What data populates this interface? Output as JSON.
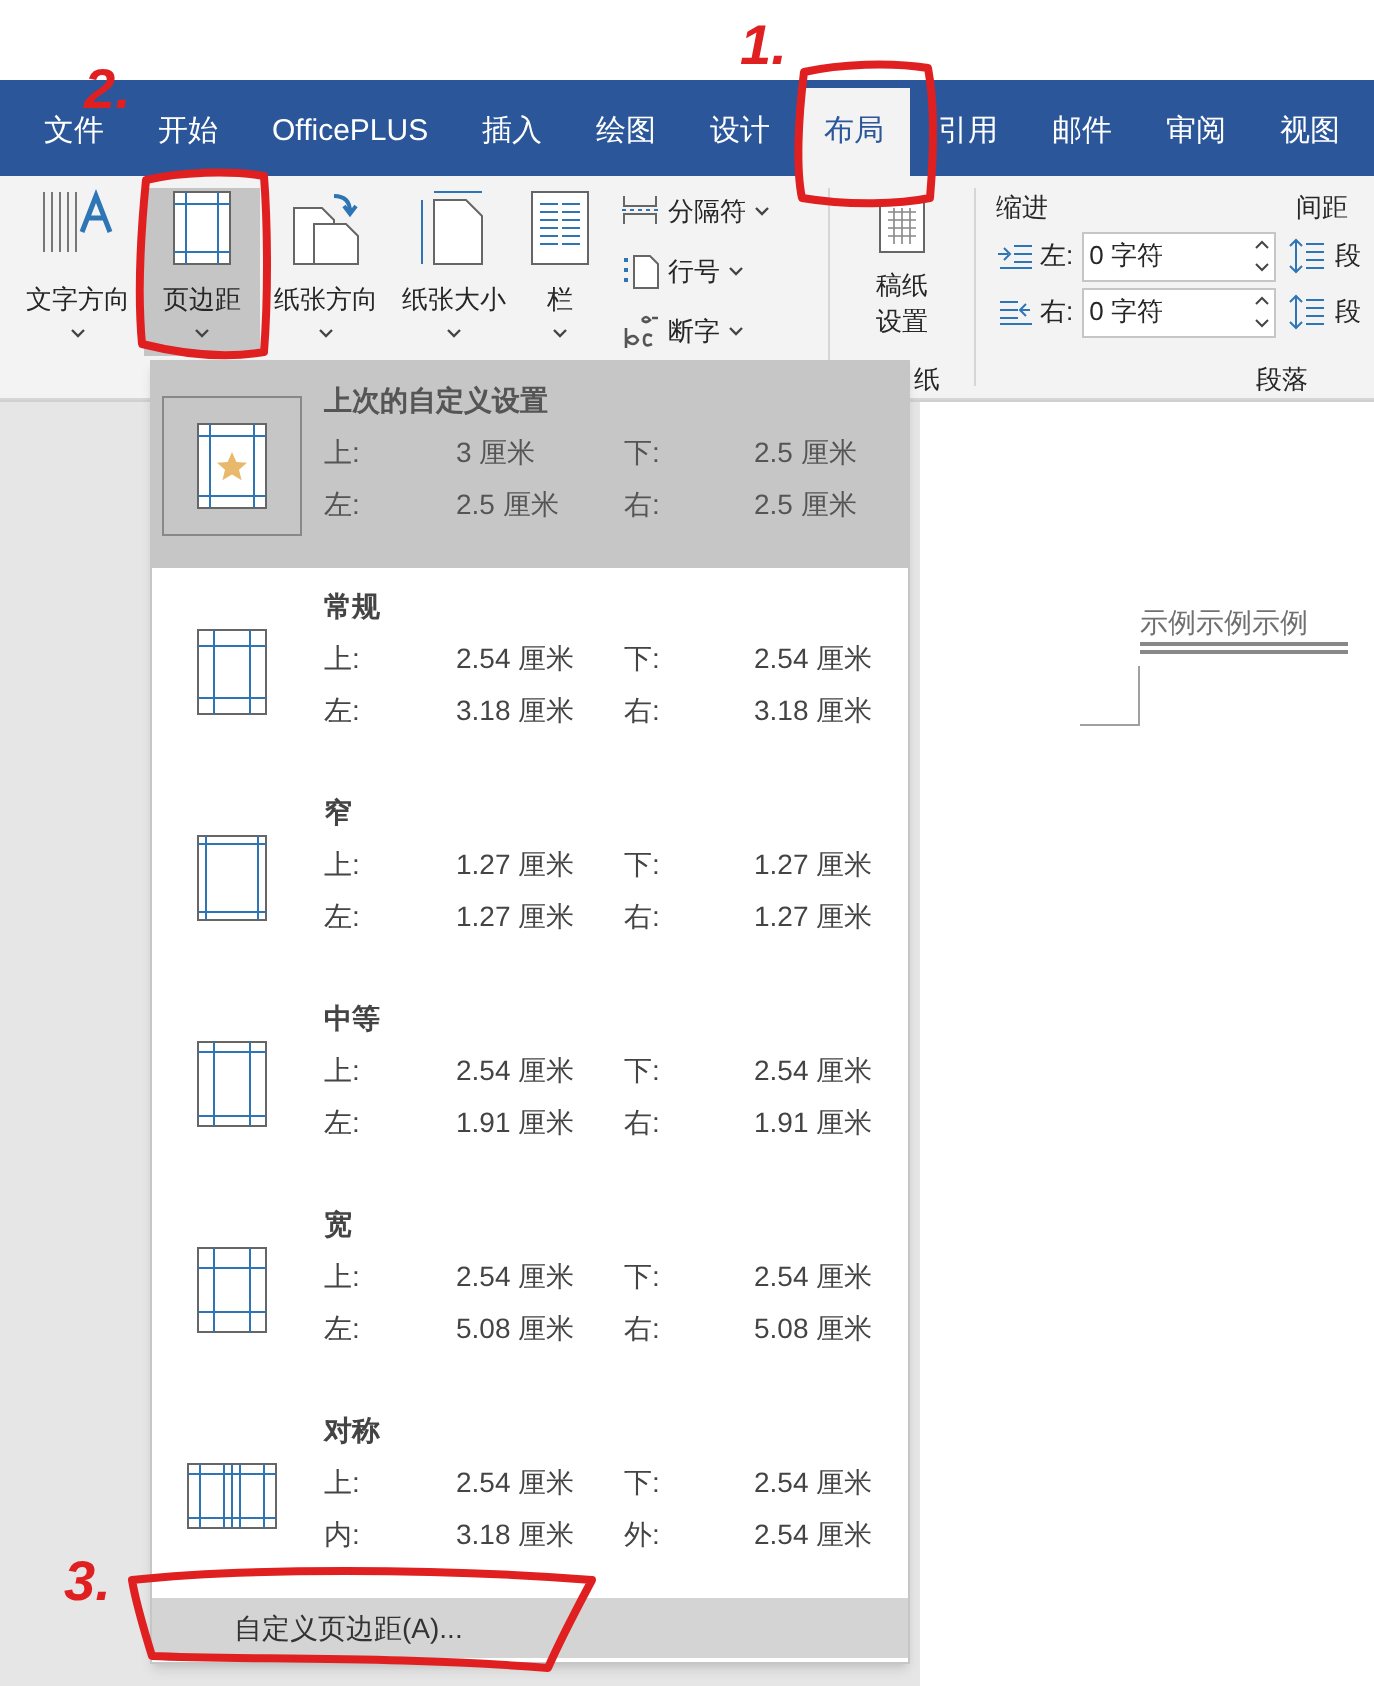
{
  "tabs": [
    {
      "label": "文件",
      "selected": false
    },
    {
      "label": "开始",
      "selected": false
    },
    {
      "label": "OfficePLUS",
      "selected": false
    },
    {
      "label": "插入",
      "selected": false
    },
    {
      "label": "绘图",
      "selected": false
    },
    {
      "label": "设计",
      "selected": false
    },
    {
      "label": "布局",
      "selected": true
    },
    {
      "label": "引用",
      "selected": false
    },
    {
      "label": "邮件",
      "selected": false
    },
    {
      "label": "审阅",
      "selected": false
    },
    {
      "label": "视图",
      "selected": false
    }
  ],
  "ribbon": {
    "big_buttons": [
      {
        "kind": "text-direction",
        "label": "文字方向",
        "pressed": false
      },
      {
        "kind": "margins",
        "label": "页边距",
        "pressed": true
      },
      {
        "kind": "orientation",
        "label": "纸张方向",
        "pressed": false
      },
      {
        "kind": "size",
        "label": "纸张大小",
        "pressed": false
      },
      {
        "kind": "columns",
        "label": "栏",
        "pressed": false
      }
    ],
    "small_buttons": [
      {
        "kind": "breaks",
        "label": "分隔符"
      },
      {
        "kind": "line-numbers",
        "label": "行号"
      },
      {
        "kind": "hyphenation",
        "label": "断字"
      }
    ],
    "manuscript": {
      "label": "稿纸设置",
      "group_label": "纸"
    },
    "paragraph": {
      "indent_label": "缩进",
      "spacing_label": "间距",
      "fields": [
        {
          "kind": "left",
          "label": "左:",
          "value": "0 字符",
          "spacing_label": "段"
        },
        {
          "kind": "right",
          "label": "右:",
          "value": "0 字符",
          "spacing_label": "段"
        }
      ],
      "group_label": "段落"
    }
  },
  "margins_menu": {
    "items": [
      {
        "kind": "custom",
        "title": "上次的自定义设置",
        "selected": true,
        "rows": [
          [
            "上:",
            "3 厘米",
            "下:",
            "2.5 厘米"
          ],
          [
            "左:",
            "2.5 厘米",
            "右:",
            "2.5 厘米"
          ]
        ]
      },
      {
        "kind": "normal",
        "title": "常规",
        "selected": false,
        "rows": [
          [
            "上:",
            "2.54 厘米",
            "下:",
            "2.54 厘米"
          ],
          [
            "左:",
            "3.18 厘米",
            "右:",
            "3.18 厘米"
          ]
        ]
      },
      {
        "kind": "narrow",
        "title": "窄",
        "selected": false,
        "rows": [
          [
            "上:",
            "1.27 厘米",
            "下:",
            "1.27 厘米"
          ],
          [
            "左:",
            "1.27 厘米",
            "右:",
            "1.27 厘米"
          ]
        ]
      },
      {
        "kind": "moderate",
        "title": "中等",
        "selected": false,
        "rows": [
          [
            "上:",
            "2.54 厘米",
            "下:",
            "2.54 厘米"
          ],
          [
            "左:",
            "1.91 厘米",
            "右:",
            "1.91 厘米"
          ]
        ]
      },
      {
        "kind": "wide",
        "title": "宽",
        "selected": false,
        "rows": [
          [
            "上:",
            "2.54 厘米",
            "下:",
            "2.54 厘米"
          ],
          [
            "左:",
            "5.08 厘米",
            "右:",
            "5.08 厘米"
          ]
        ]
      },
      {
        "kind": "mirrored",
        "title": "对称",
        "selected": false,
        "rows": [
          [
            "上:",
            "2.54 厘米",
            "下:",
            "2.54 厘米"
          ],
          [
            "内:",
            "3.18 厘米",
            "外:",
            "2.54 厘米"
          ]
        ]
      }
    ],
    "custom_button": "自定义页边距(A)..."
  },
  "document": {
    "text": "示例示例示例"
  },
  "annotations": [
    {
      "label": "1."
    },
    {
      "label": "2."
    },
    {
      "label": "3."
    }
  ]
}
